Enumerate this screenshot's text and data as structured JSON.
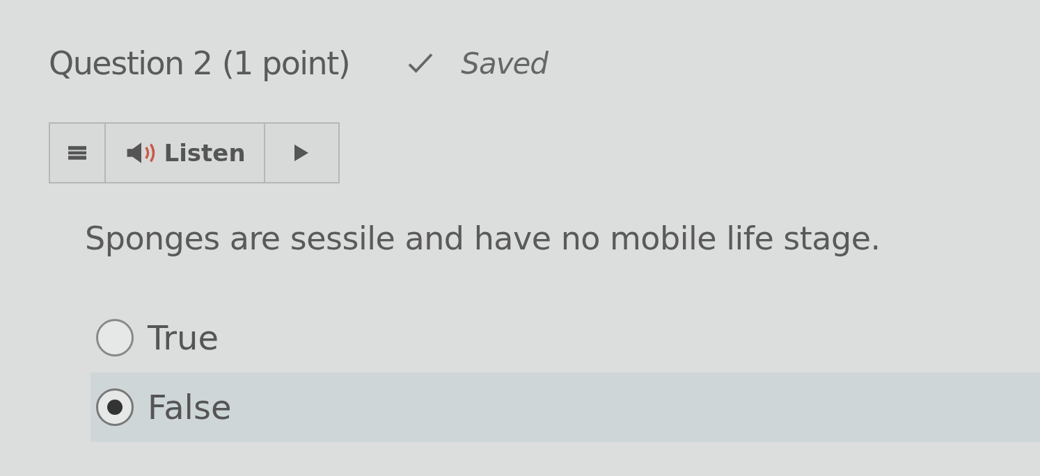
{
  "question": {
    "title": "Question 2",
    "points": "(1 point)",
    "status": "Saved"
  },
  "toolbar": {
    "listen_label": "Listen"
  },
  "prompt": "Sponges are sessile and have no mobile life stage.",
  "options": [
    {
      "label": "True",
      "selected": false
    },
    {
      "label": "False",
      "selected": true
    }
  ]
}
